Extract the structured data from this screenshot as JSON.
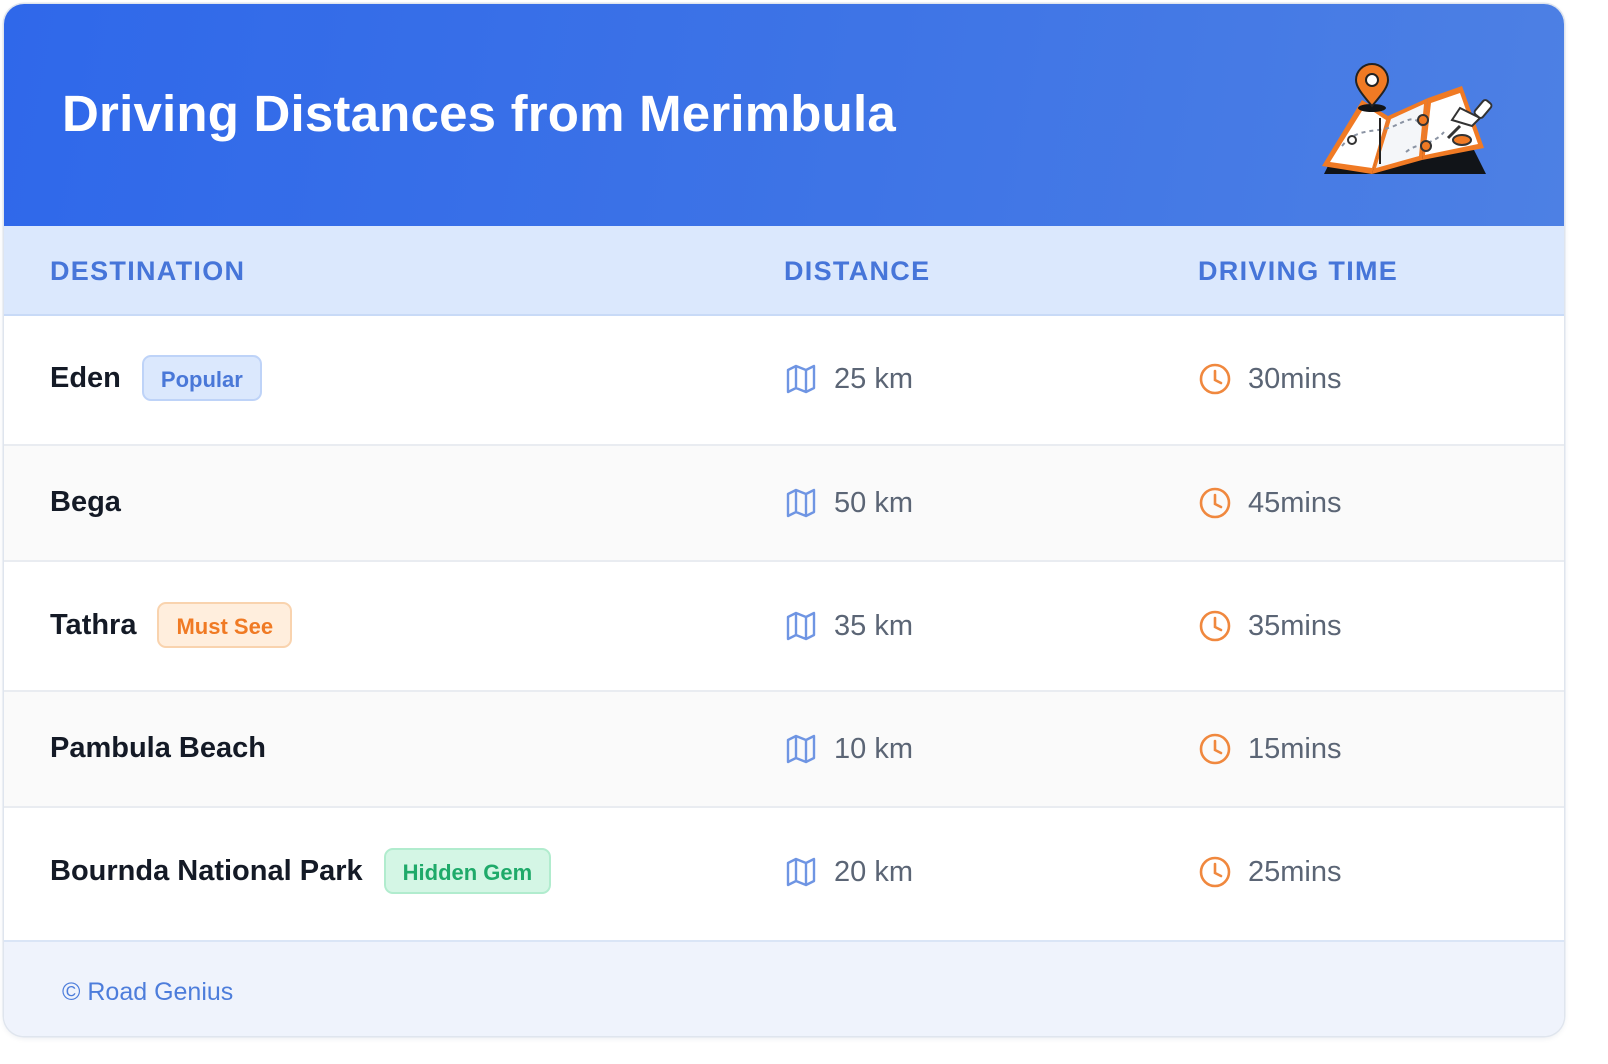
{
  "header": {
    "title": "Driving Distances from Merimbula",
    "illustration_icon": "folded-map-with-location-pin-icon"
  },
  "table": {
    "columns": [
      "DESTINATION",
      "DISTANCE",
      "DRIVING TIME"
    ],
    "rows": [
      {
        "destination": "Eden",
        "badge": "Popular",
        "badge_color": "#4a78d8",
        "distance": "25 km",
        "time": "30mins"
      },
      {
        "destination": "Bega",
        "badge": "",
        "badge_color": "",
        "distance": "50 km",
        "time": "45mins"
      },
      {
        "destination": "Tathra",
        "badge": "Must See",
        "badge_color": "#f07a24",
        "distance": "35 km",
        "time": "35mins"
      },
      {
        "destination": "Pambula Beach",
        "badge": "",
        "badge_color": "",
        "distance": "10 km",
        "time": "15mins"
      },
      {
        "destination": "Bournda National Park",
        "badge": "Hidden Gem",
        "badge_color": "#1faa6a",
        "distance": "20 km",
        "time": "25mins"
      }
    ],
    "distance_icon": "map-icon",
    "time_icon": "clock-icon"
  },
  "footer": {
    "credit": "© Road Genius"
  },
  "colors": {
    "header_start": "#2f68ea",
    "header_end": "#4d80e4",
    "accent_blue": "#4675d9",
    "accent_orange": "#f0883e"
  }
}
